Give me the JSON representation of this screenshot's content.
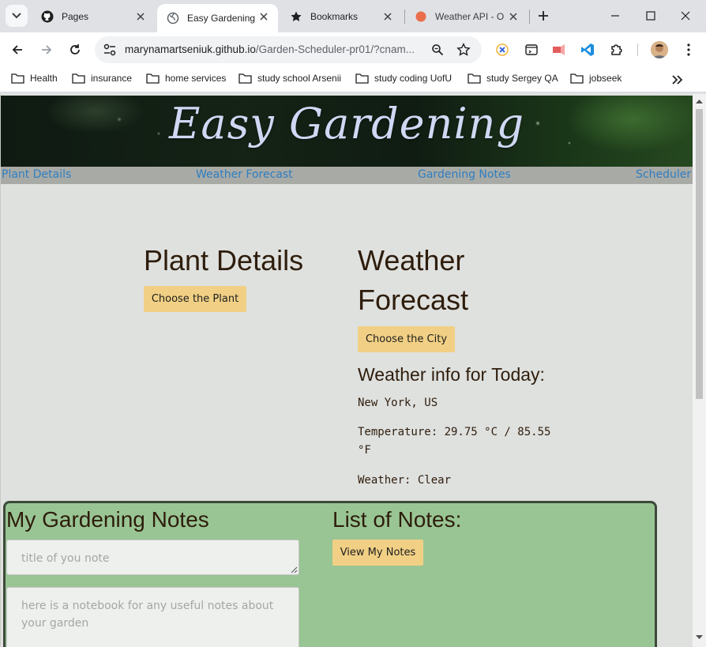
{
  "browser": {
    "tabs": [
      {
        "title": "Pages",
        "icon": "github-icon",
        "active": false
      },
      {
        "title": "Easy Gardening",
        "icon": "globe-icon",
        "active": true
      },
      {
        "title": "Bookmarks",
        "icon": "star-icon",
        "active": false
      },
      {
        "title": "Weather API - O",
        "icon": "openweather-icon",
        "active": false
      }
    ],
    "url_host": "marynamartseniuk.github.io",
    "url_path": "/Garden-Scheduler-pr01/?cnam...",
    "bookmarks": [
      {
        "label": "Health"
      },
      {
        "label": "insurance"
      },
      {
        "label": "home services"
      },
      {
        "label": "study school Arsenii"
      },
      {
        "label": "study coding UofU"
      },
      {
        "label": "study Sergey QA"
      },
      {
        "label": "jobseek"
      }
    ]
  },
  "page": {
    "banner_title": "Easy Gardening",
    "nav": [
      {
        "label": "Plant Details"
      },
      {
        "label": "Weather Forecast"
      },
      {
        "label": "Gardening Notes"
      },
      {
        "label": "Scheduler"
      }
    ],
    "plant": {
      "title": "Plant Details",
      "button": "Choose the Plant"
    },
    "weather": {
      "title_line1": "Weather",
      "title_line2": "Forecast",
      "button": "Choose the City",
      "today_title": "Weather info for Today:",
      "location": "New York, US",
      "temperature_line1": "Temperature: 29.75 °C / 85.55",
      "temperature_line2": "°F",
      "condition": "Weather: Clear"
    },
    "notes": {
      "title": "My Gardening Notes",
      "title_placeholder": "title of you note",
      "body_placeholder": "here is a notebook for any useful notes about your garden",
      "list_title": "List of Notes:",
      "view_button": "View My Notes"
    }
  },
  "colors": {
    "accent_button": "#f1d085",
    "notes_panel": "#99c594",
    "nav_link": "#2f7fc1",
    "heading": "#2e1d0c"
  }
}
